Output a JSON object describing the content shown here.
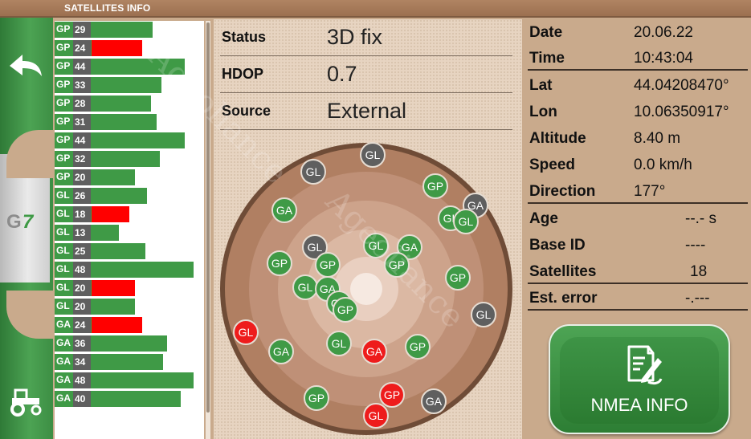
{
  "title": "SATELLITES INFO",
  "watermarks": [
    "Ageoliance",
    "Ageoliance"
  ],
  "rail": {
    "back_icon": "back-arrow-icon",
    "logo_label": "G7",
    "tractor_icon": "tractor-icon"
  },
  "satellites_list": [
    {
      "system": "GP",
      "id": "29",
      "signal": 0.67,
      "status": "ok"
    },
    {
      "system": "GP",
      "id": "24",
      "signal": 0.6,
      "status": "low"
    },
    {
      "system": "GP",
      "id": "44",
      "signal": 0.89,
      "status": "ok"
    },
    {
      "system": "GP",
      "id": "33",
      "signal": 0.73,
      "status": "ok"
    },
    {
      "system": "GP",
      "id": "28",
      "signal": 0.66,
      "status": "ok"
    },
    {
      "system": "GP",
      "id": "31",
      "signal": 0.7,
      "status": "ok"
    },
    {
      "system": "GP",
      "id": "44",
      "signal": 0.89,
      "status": "ok"
    },
    {
      "system": "GP",
      "id": "32",
      "signal": 0.72,
      "status": "ok"
    },
    {
      "system": "GP",
      "id": "20",
      "signal": 0.55,
      "status": "ok"
    },
    {
      "system": "GL",
      "id": "26",
      "signal": 0.63,
      "status": "ok"
    },
    {
      "system": "GL",
      "id": "18",
      "signal": 0.51,
      "status": "low"
    },
    {
      "system": "GL",
      "id": "13",
      "signal": 0.44,
      "status": "ok"
    },
    {
      "system": "GL",
      "id": "25",
      "signal": 0.62,
      "status": "ok"
    },
    {
      "system": "GL",
      "id": "48",
      "signal": 0.95,
      "status": "ok"
    },
    {
      "system": "GL",
      "id": "20",
      "signal": 0.55,
      "status": "low"
    },
    {
      "system": "GL",
      "id": "20",
      "signal": 0.55,
      "status": "ok"
    },
    {
      "system": "GA",
      "id": "24",
      "signal": 0.6,
      "status": "low"
    },
    {
      "system": "GA",
      "id": "36",
      "signal": 0.77,
      "status": "ok"
    },
    {
      "system": "GA",
      "id": "34",
      "signal": 0.74,
      "status": "ok"
    },
    {
      "system": "GA",
      "id": "48",
      "signal": 0.95,
      "status": "ok"
    },
    {
      "system": "GA",
      "id": "40",
      "signal": 0.86,
      "status": "ok"
    }
  ],
  "status_block": {
    "status_label": "Status",
    "status_value": "3D fix",
    "hdop_label": "HDOP",
    "hdop_value": "0.7",
    "source_label": "Source",
    "source_value": "External"
  },
  "sky_plot": {
    "satellites": [
      {
        "label": "GL",
        "color": "grey"
      },
      {
        "label": "GL",
        "color": "grey"
      },
      {
        "label": "GP",
        "color": "green"
      },
      {
        "label": "GA",
        "color": "grey"
      },
      {
        "label": "GL",
        "color": "green"
      },
      {
        "label": "GL",
        "color": "green"
      },
      {
        "label": "GA",
        "color": "green"
      },
      {
        "label": "GL",
        "color": "grey"
      },
      {
        "label": "GL",
        "color": "green"
      },
      {
        "label": "GA",
        "color": "green"
      },
      {
        "label": "GP",
        "color": "green"
      },
      {
        "label": "GP",
        "color": "green"
      },
      {
        "label": "GP",
        "color": "green"
      },
      {
        "label": "GL",
        "color": "green"
      },
      {
        "label": "GA",
        "color": "green"
      },
      {
        "label": "GP",
        "color": "green"
      },
      {
        "label": "GA",
        "color": "green"
      },
      {
        "label": "GP",
        "color": "green"
      },
      {
        "label": "GL",
        "color": "grey"
      },
      {
        "label": "GL",
        "color": "red"
      },
      {
        "label": "GA",
        "color": "green"
      },
      {
        "label": "GL",
        "color": "green"
      },
      {
        "label": "GA",
        "color": "red"
      },
      {
        "label": "GP",
        "color": "green"
      },
      {
        "label": "GP",
        "color": "green"
      },
      {
        "label": "GP",
        "color": "red"
      },
      {
        "label": "GA",
        "color": "grey"
      },
      {
        "label": "GL",
        "color": "red"
      }
    ]
  },
  "gnss_info": {
    "date_label": "Date",
    "date_value": "20.06.22",
    "time_label": "Time",
    "time_value": "10:43:04",
    "lat_label": "Lat",
    "lat_value": "44.04208470°",
    "lon_label": "Lon",
    "lon_value": "10.06350917°",
    "altitude_label": "Altitude",
    "altitude_value": "8.40 m",
    "speed_label": "Speed",
    "speed_value": "0.0 km/h",
    "direction_label": "Direction",
    "direction_value": "177°",
    "age_label": "Age",
    "age_value": "--.- s",
    "base_id_label": "Base ID",
    "base_id_value": "----",
    "satellites_label": "Satellites",
    "satellites_value": "18",
    "est_error_label": "Est. error",
    "est_error_value": "-.---"
  },
  "nmea_button": {
    "label": "NMEA INFO",
    "icon": "nmea-document-icon"
  }
}
